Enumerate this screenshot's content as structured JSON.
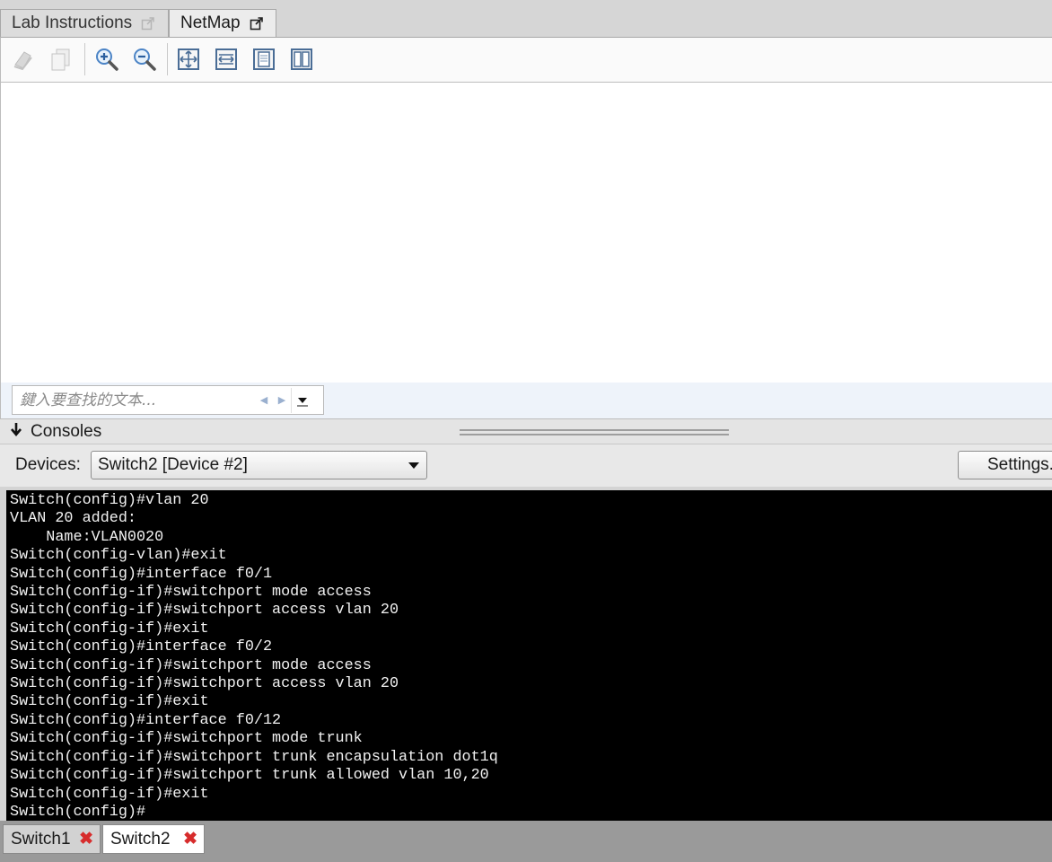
{
  "top_tabs": {
    "lab_instructions": "Lab Instructions",
    "netmap": "NetMap"
  },
  "toolbar": {
    "buttons": [
      "print-icon",
      "copy-icon",
      "zoom-in-icon",
      "zoom-out-icon",
      "fit-page-icon",
      "fit-width-icon",
      "single-page-icon",
      "two-page-icon"
    ]
  },
  "find": {
    "placeholder": "鍵入要查找的文本..."
  },
  "consoles": {
    "title": "Consoles",
    "devices_label": "Devices:",
    "selected_device": "Switch2 [Device #2]",
    "settings_label": "Settings..."
  },
  "terminal": {
    "lines": [
      "Switch(config)#vlan 20",
      "VLAN 20 added:",
      "    Name:VLAN0020",
      "Switch(config-vlan)#exit",
      "Switch(config)#interface f0/1",
      "Switch(config-if)#switchport mode access",
      "Switch(config-if)#switchport access vlan 20",
      "Switch(config-if)#exit",
      "Switch(config)#interface f0/2",
      "Switch(config-if)#switchport mode access",
      "Switch(config-if)#switchport access vlan 20",
      "Switch(config-if)#exit",
      "Switch(config)#interface f0/12",
      "Switch(config-if)#switchport mode trunk",
      "Switch(config-if)#switchport trunk encapsulation dot1q",
      "Switch(config-if)#switchport trunk allowed vlan 10,20",
      "Switch(config-if)#exit",
      "Switch(config)#"
    ]
  },
  "console_tabs": [
    {
      "label": "Switch1",
      "active": false
    },
    {
      "label": "Switch2",
      "active": true
    }
  ]
}
